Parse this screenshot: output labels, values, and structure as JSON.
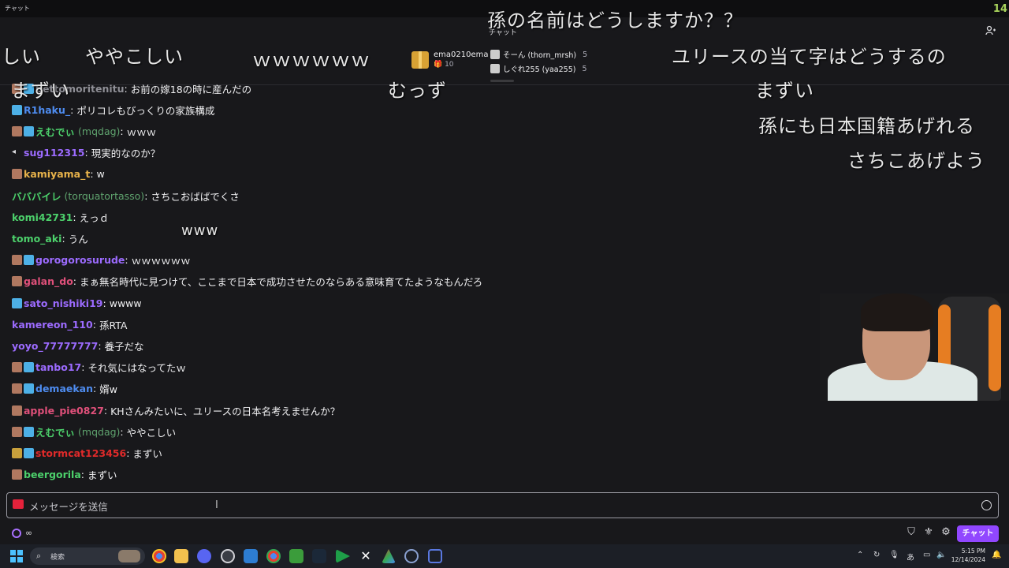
{
  "window": {
    "title": "チャット",
    "corner_badge": "14"
  },
  "header": {
    "title": "チャット",
    "gifter_main": {
      "name": "ema0210ema",
      "count": "10"
    },
    "gifters": [
      {
        "name": "そーん (thorn_mrsh)",
        "count": "5"
      },
      {
        "name": "しぐれ255 (yaa255)",
        "count": "5"
      }
    ]
  },
  "messages": [
    {
      "user": "bettomoritenitu",
      "login": "",
      "text": "お前の嫁18の時に産んだの",
      "color": "#8f8f96",
      "badges": [
        "face",
        "sub"
      ]
    },
    {
      "user": "R1haku_",
      "login": "",
      "text": "ポリコレもびっくりの家族構成",
      "color": "#4e8cf0",
      "badges": [
        "sub"
      ]
    },
    {
      "user": "えむでぃ",
      "login": "(mqdag)",
      "text": "ｗｗｗ",
      "color": "#4cd06b",
      "badges": [
        "face",
        "sub"
      ]
    },
    {
      "user": "sug112315",
      "login": "",
      "text": "現実的なのか？",
      "color": "#9c6bff",
      "badges": [
        "mute"
      ]
    },
    {
      "user": "kamiyama_t",
      "login": "",
      "text": "w",
      "color": "#e7b24a",
      "badges": [
        "face"
      ]
    },
    {
      "user": "バババイレ",
      "login": "(torquatortasso)",
      "text": "さちこおばばでくさ",
      "color": "#4cd06b",
      "badges": []
    },
    {
      "user": "komi42731",
      "login": "",
      "text": "えっｄ",
      "color": "#4cd06b",
      "badges": []
    },
    {
      "user": "tomo_aki",
      "login": "",
      "text": "うん",
      "color": "#4cd06b",
      "badges": []
    },
    {
      "user": "gorogorosurude",
      "login": "",
      "text": "ｗｗｗｗｗｗ",
      "color": "#9c6bff",
      "badges": [
        "face",
        "sub"
      ]
    },
    {
      "user": "galan_do",
      "login": "",
      "text": "まぁ無名時代に見つけて、ここまで日本で成功させたのならある意味育てたようなもんだろ",
      "color": "#e0507a",
      "badges": [
        "face"
      ]
    },
    {
      "user": "sato_nishiki19",
      "login": "",
      "text": "wwww",
      "color": "#9c6bff",
      "badges": [
        "sub"
      ]
    },
    {
      "user": "kamereon_110",
      "login": "",
      "text": "孫RTA",
      "color": "#9c6bff",
      "badges": []
    },
    {
      "user": "yoyo_77777777",
      "login": "",
      "text": "養子だな",
      "color": "#9c6bff",
      "badges": []
    },
    {
      "user": "tanbo17",
      "login": "",
      "text": "それ気にはなってたｗ",
      "color": "#9c6bff",
      "badges": [
        "face",
        "sub"
      ]
    },
    {
      "user": "demaekan",
      "login": "",
      "text": "婿w",
      "color": "#4e8cf0",
      "badges": [
        "face",
        "sub"
      ]
    },
    {
      "user": "apple_pie0827",
      "login": "",
      "text": "KHさんみたいに、ユリースの日本名考えませんか？",
      "color": "#e0507a",
      "badges": [
        "face"
      ]
    },
    {
      "user": "えむでぃ",
      "login": "(mqdag)",
      "text": "ややこしい",
      "color": "#4cd06b",
      "badges": [
        "face",
        "sub"
      ]
    },
    {
      "user": "stormcat123456",
      "login": "",
      "text": "まずい",
      "color": "#e02a2a",
      "badges": [
        "gold",
        "sub"
      ]
    },
    {
      "user": "beergorila",
      "login": "",
      "text": "まずい",
      "color": "#4cd06b",
      "badges": [
        "face"
      ]
    }
  ],
  "danmaku": [
    "孫の名前はどうしますか？？",
    "しい",
    "ややこしい",
    "ｗｗｗｗｗｗ",
    "ユリースの当て字はどうするの",
    "まずい",
    "むっず",
    "まずい",
    "孫にも日本国籍あげれる",
    "さちこあげよう",
    "www"
  ],
  "input": {
    "placeholder": "メッセージを送信",
    "caret": "I"
  },
  "bottom": {
    "points": "∞",
    "chat_button": "チャット"
  },
  "taskbar": {
    "search_label": "検索",
    "time": "5:15 PM",
    "date": "12/14/2024",
    "ime": "あ"
  }
}
